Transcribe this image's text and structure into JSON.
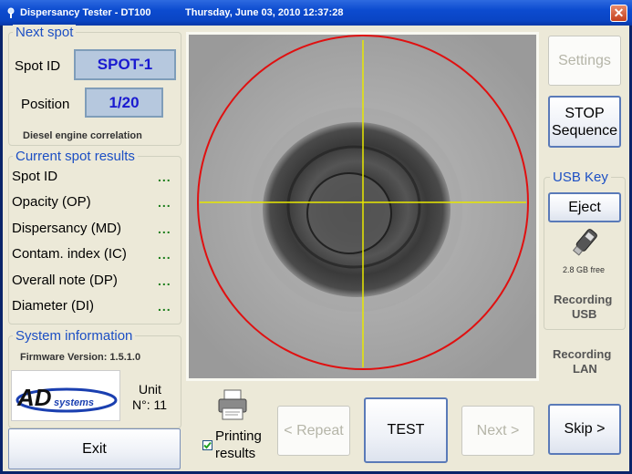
{
  "window": {
    "title": "Dispersancy Tester - DT100",
    "datetime": "Thursday, June 03, 2010   12:37:28",
    "close_label": "✕"
  },
  "next_spot": {
    "title": "Next spot",
    "spot_id_label": "Spot ID",
    "spot_id_value": "SPOT-1",
    "position_label": "Position",
    "position_value": "1/20",
    "correlation": "Diesel engine correlation"
  },
  "current_results": {
    "title": "Current spot results",
    "rows": [
      {
        "label": "Spot ID",
        "value": "..."
      },
      {
        "label": "Opacity (OP)",
        "value": "..."
      },
      {
        "label": "Dispersancy (MD)",
        "value": "..."
      },
      {
        "label": "Contam. index (IC)",
        "value": "..."
      },
      {
        "label": "Overall note (DP)",
        "value": "..."
      },
      {
        "label": "Diameter (DI)",
        "value": "..."
      }
    ]
  },
  "system_info": {
    "title": "System information",
    "firmware": "Firmware Version: 1.5.1.0",
    "logo_text": "AD systems",
    "unit_label": "Unit",
    "unit_number": "N°: 11"
  },
  "buttons": {
    "exit": "Exit",
    "repeat": "< Repeat",
    "test": "TEST",
    "next": "Next >",
    "skip": "Skip >",
    "settings": "Settings",
    "stop_line1": "STOP",
    "stop_line2": "Sequence",
    "eject": "Eject"
  },
  "printing": {
    "checked": true,
    "label_line1": "Printing",
    "label_line2": "results"
  },
  "usb": {
    "title": "USB Key",
    "free_space": "2.8 GB free",
    "recording_usb_line1": "Recording",
    "recording_usb_line2": "USB"
  },
  "recording_lan": {
    "line1": "Recording",
    "line2": "LAN"
  },
  "colors": {
    "accent_blue": "#1c4fc4",
    "circle_red": "#e01010",
    "crosshair_yellow": "#e8e800",
    "dots_green": "#1a7d1a"
  }
}
